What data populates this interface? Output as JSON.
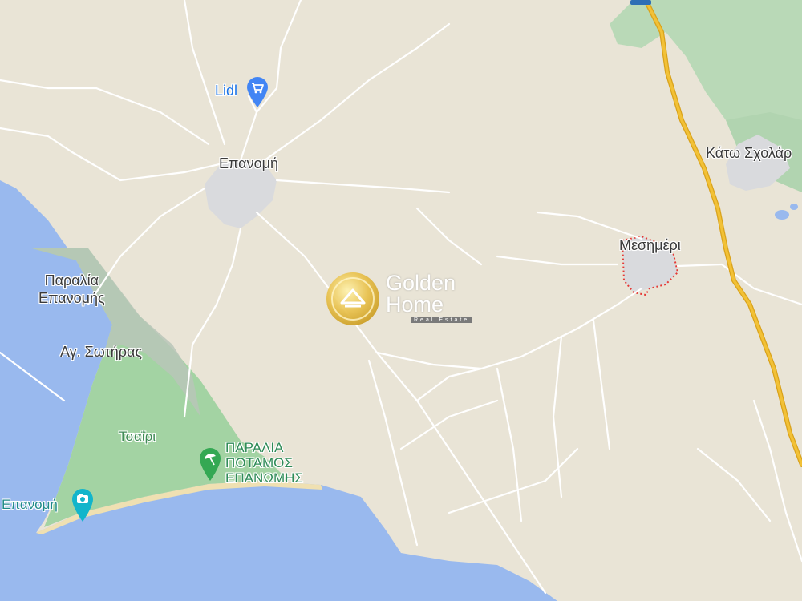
{
  "map": {
    "colors": {
      "land": "#e9e4d6",
      "sea": "#99b9ee",
      "park": "#a3d3a3",
      "forest": "#b9d9b7",
      "town": "#d9dadd",
      "road": "#ffffff",
      "highway": "#f2c136",
      "highway_casing": "#d9a21b",
      "boundary": "#e53935",
      "beach": "#efe0b2"
    },
    "labels": {
      "lidl": "Lidl",
      "epanomi": "Επανομή",
      "kato_scholari": "Κάτω Σχολάρ",
      "mesimeri": "Μεσημέρι",
      "paralia_epanomis": "Παραλία\nΕπανομής",
      "ag_sotiras": "Αγ. Σωτήρας",
      "tsairi": "Τσαΐρι",
      "paralia_potamos": "ΠΑΡΑΛΙΑ\nΠΟΤΑΜΟΣ\nΕΠΑΝΩΜΗΣ",
      "epanomi_beach": "Επανομή"
    },
    "icons": {
      "lidl_pin": "shopping-cart-icon",
      "beach_pin": "beach-umbrella-icon",
      "photo_pin": "camera-icon"
    },
    "watermark": {
      "line1": "Golden",
      "line2": "Home",
      "sub": "Real Estate"
    }
  }
}
